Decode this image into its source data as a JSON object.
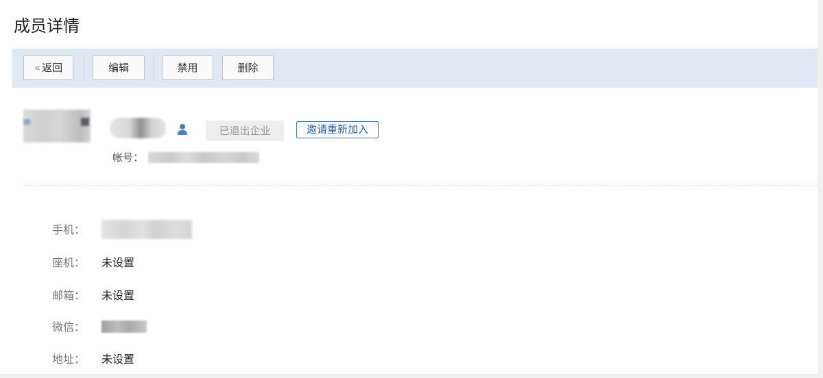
{
  "page": {
    "title": "成员详情"
  },
  "toolbar": {
    "back_label": "返回",
    "edit_label": "编辑",
    "disable_label": "禁用",
    "delete_label": "删除"
  },
  "member": {
    "status_badge": "已退出企业",
    "invite_label": "邀请重新加入",
    "account_label": "帐号："
  },
  "details": [
    {
      "label": "手机：",
      "value": ""
    },
    {
      "label": "座机：",
      "value": "未设置"
    },
    {
      "label": "邮箱：",
      "value": "未设置"
    },
    {
      "label": "微信：",
      "value": ""
    },
    {
      "label": "地址：",
      "value": "未设置"
    }
  ],
  "icons": {
    "back": "double-chevron-left-icon",
    "user": "user-icon"
  },
  "colors": {
    "toolbar_bg": "#dfe8f3",
    "link_blue": "#2d63a8",
    "user_icon": "#4a7fc1",
    "badge_bg": "#eeeeee"
  }
}
